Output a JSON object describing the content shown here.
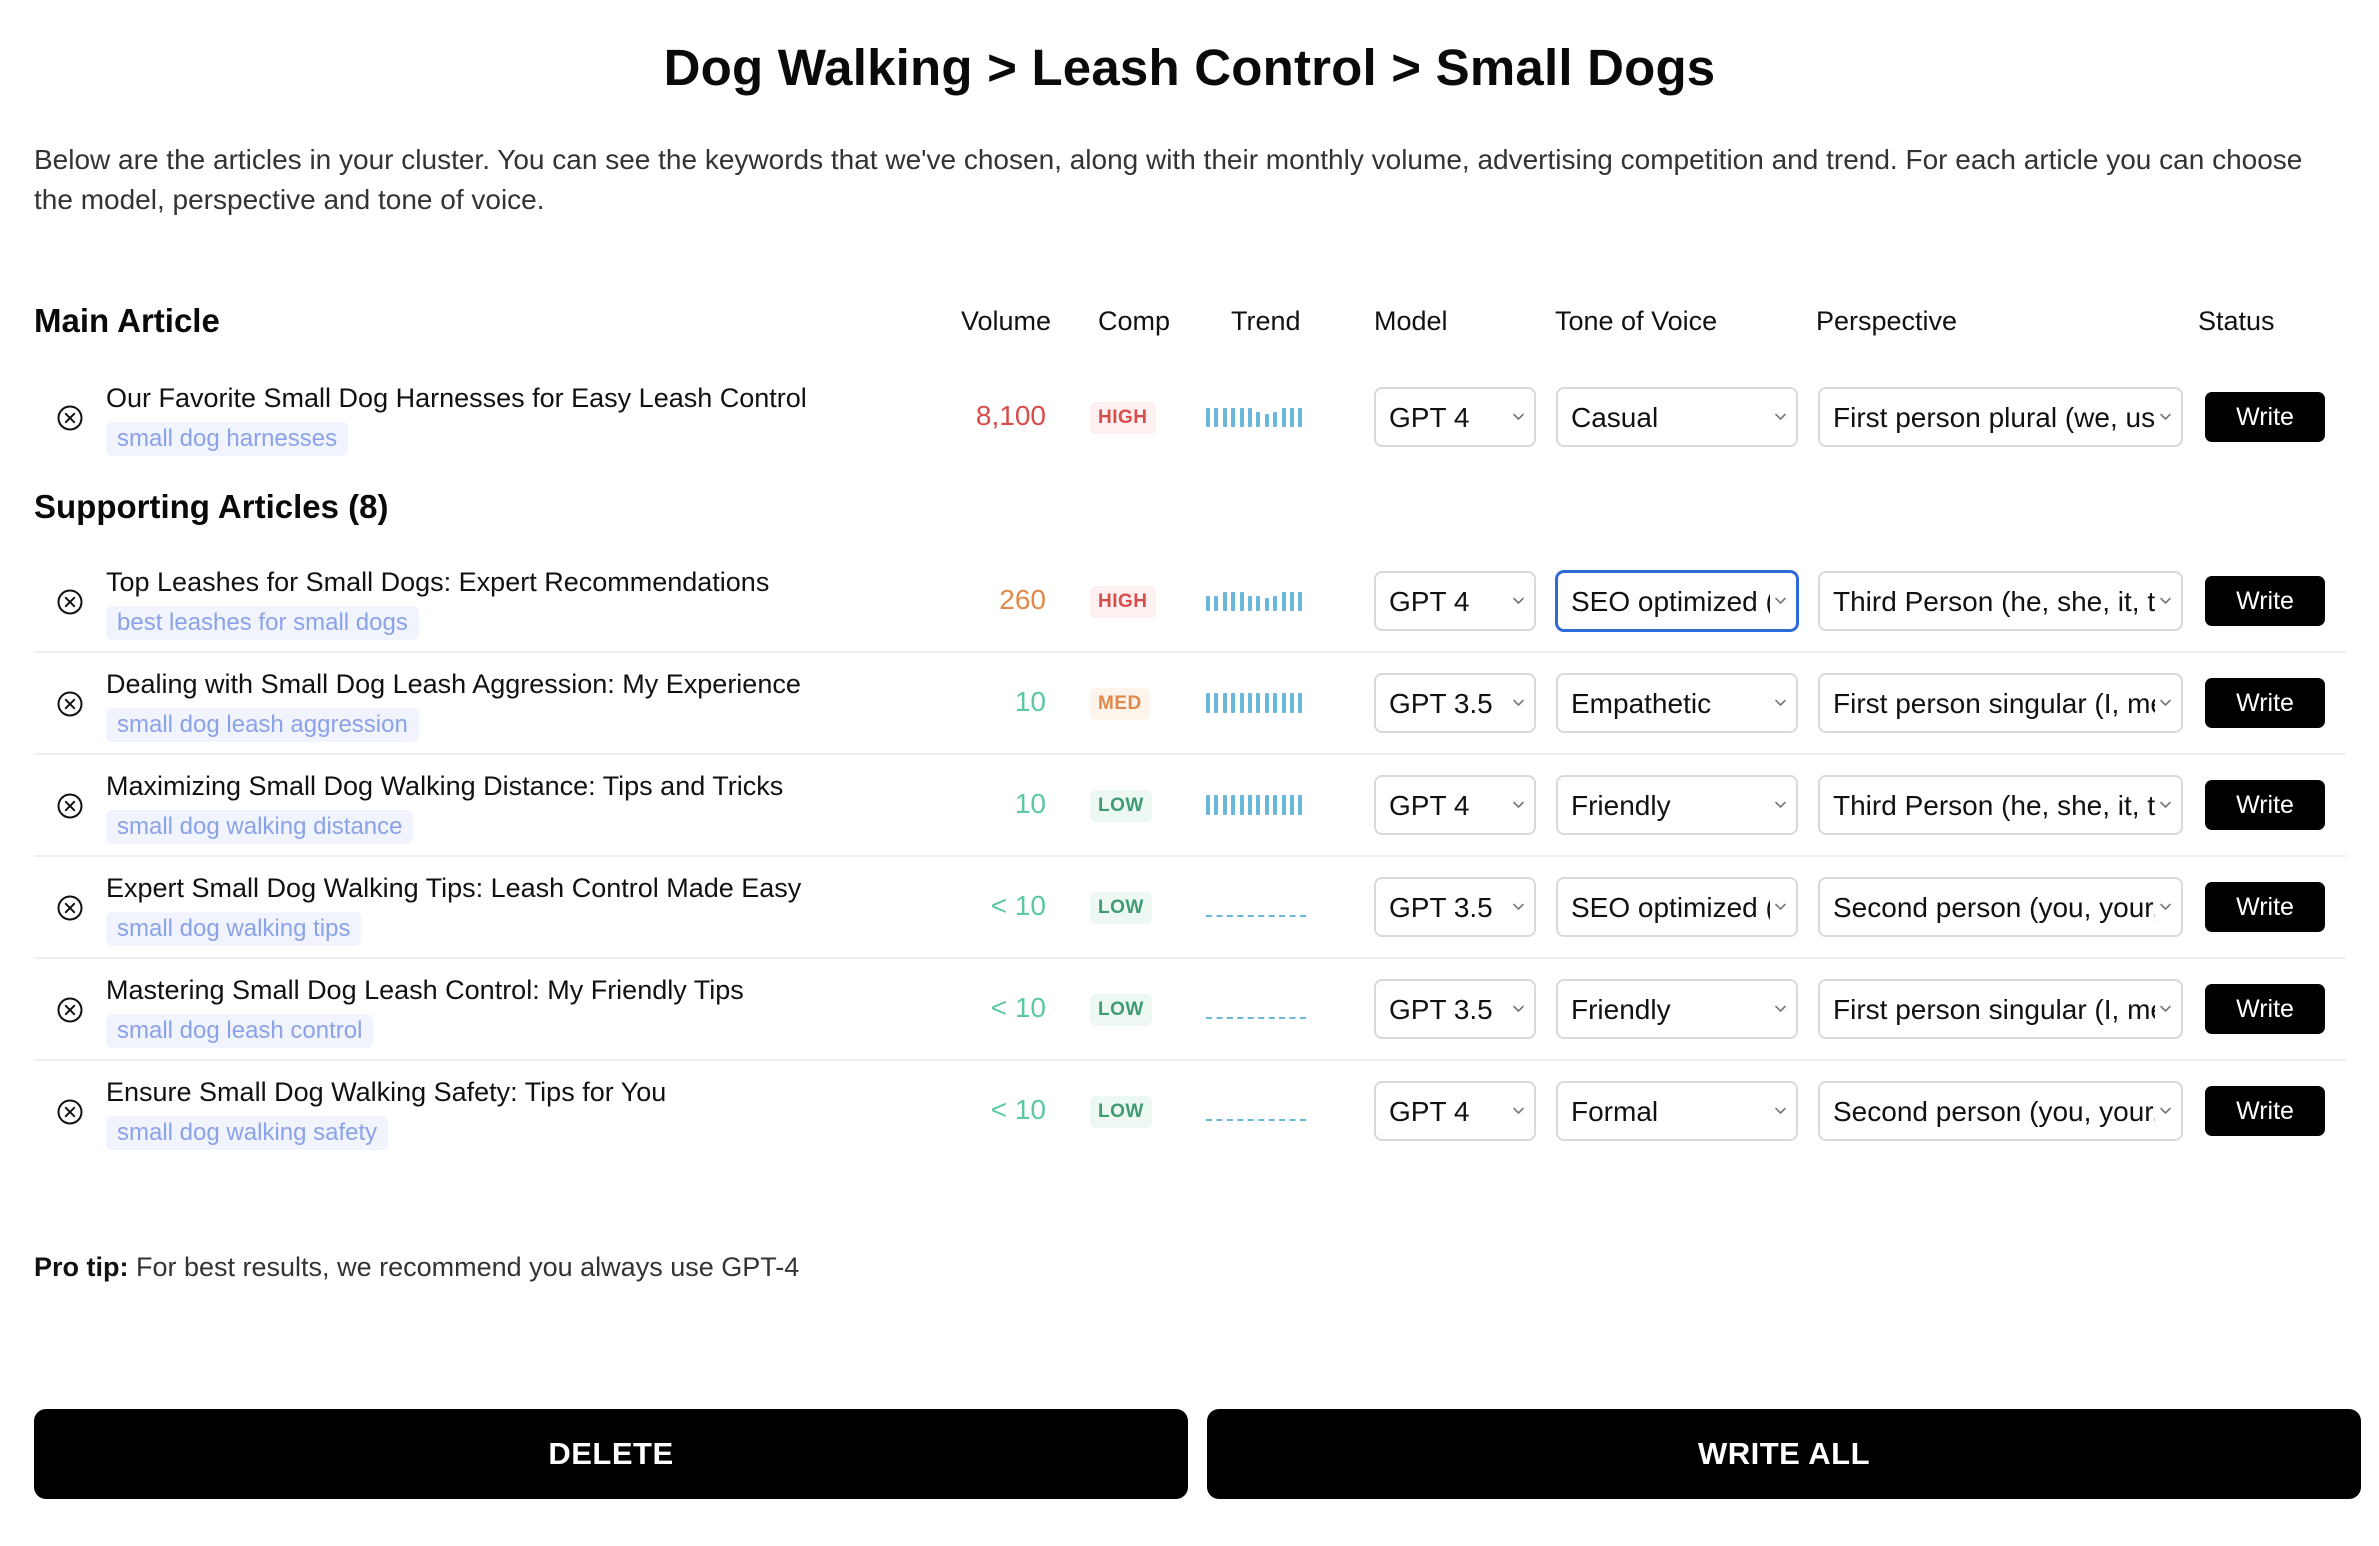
{
  "page": {
    "title": "Dog Walking > Leash Control > Small Dogs",
    "intro": "Below are the articles in your cluster. You can see the keywords that we've chosen, along with their monthly volume, advertising competition and trend. For each article you can choose the model, perspective and tone of voice."
  },
  "columns": {
    "main_article": "Main Article",
    "volume": "Volume",
    "comp": "Comp",
    "trend": "Trend",
    "model": "Model",
    "tone": "Tone of Voice",
    "perspective": "Perspective",
    "status": "Status"
  },
  "supporting_label": "Supporting Articles (8)",
  "main_article": {
    "title": "Our Favorite Small Dog Harnesses for Easy Leash Control",
    "keyword": "small dog harnesses",
    "volume": "8,100",
    "volume_color": "#d94c4c",
    "comp": "HIGH",
    "comp_level": "high",
    "trend": [
      0.85,
      0.85,
      0.85,
      0.85,
      0.85,
      0.85,
      0.7,
      0.6,
      0.7,
      0.85,
      0.85,
      0.85
    ],
    "model": "GPT 4",
    "tone": "Casual",
    "perspective": "First person plural (we, us, our)",
    "status": "Write"
  },
  "supporting_articles": [
    {
      "title": "Top Leashes for Small Dogs: Expert Recommendations",
      "keyword": "best leashes for small dogs",
      "volume": "260",
      "volume_color": "#e0894a",
      "comp": "HIGH",
      "comp_level": "high",
      "trend": [
        0.7,
        0.7,
        0.85,
        0.85,
        0.85,
        0.7,
        0.7,
        0.6,
        0.7,
        0.85,
        0.85,
        0.85
      ],
      "model": "GPT 4",
      "tone": "SEO optimized (",
      "tone_focused": true,
      "perspective": "Third Person (he, she, it, they)",
      "status": "Write"
    },
    {
      "title": "Dealing with Small Dog Leash Aggression: My Experience",
      "keyword": "small dog leash aggression",
      "volume": "10",
      "volume_color": "#5cc8a3",
      "comp": "MED",
      "comp_level": "med",
      "trend": [
        0.9,
        0.9,
        0.9,
        0.9,
        0.9,
        0.9,
        0.9,
        0.9,
        0.9,
        0.9,
        0.9,
        0.9
      ],
      "model": "GPT 3.5",
      "tone": "Empathetic",
      "tone_focused": false,
      "perspective": "First person singular (I, me, my)",
      "status": "Write"
    },
    {
      "title": "Maximizing Small Dog Walking Distance: Tips and Tricks",
      "keyword": "small dog walking distance",
      "volume": "10",
      "volume_color": "#5cc8a3",
      "comp": "LOW",
      "comp_level": "low",
      "trend": [
        0.9,
        0.9,
        0.9,
        0.9,
        0.9,
        0.9,
        0.9,
        0.9,
        0.9,
        0.9,
        0.9,
        0.9
      ],
      "model": "GPT 4",
      "tone": "Friendly",
      "tone_focused": false,
      "perspective": "Third Person (he, she, it, they)",
      "status": "Write"
    },
    {
      "title": "Expert Small Dog Walking Tips: Leash Control Made Easy",
      "keyword": "small dog walking tips",
      "volume": "< 10",
      "volume_color": "#5cc8a3",
      "comp": "LOW",
      "comp_level": "low",
      "trend": [],
      "model": "GPT 3.5",
      "tone": "SEO optimized (",
      "tone_focused": false,
      "perspective": "Second person (you, your, yours)",
      "status": "Write"
    },
    {
      "title": "Mastering Small Dog Leash Control: My Friendly Tips",
      "keyword": "small dog leash control",
      "volume": "< 10",
      "volume_color": "#5cc8a3",
      "comp": "LOW",
      "comp_level": "low",
      "trend": [],
      "model": "GPT 3.5",
      "tone": "Friendly",
      "tone_focused": false,
      "perspective": "First person singular (I, me, my)",
      "status": "Write"
    },
    {
      "title": "Ensure Small Dog Walking Safety: Tips for You",
      "keyword": "small dog walking safety",
      "volume": "< 10",
      "volume_color": "#5cc8a3",
      "comp": "LOW",
      "comp_level": "low",
      "trend": [],
      "model": "GPT 4",
      "tone": "Formal",
      "tone_focused": false,
      "perspective": "Second person (you, your, yours)",
      "status": "Write"
    }
  ],
  "pro_tip": {
    "label": "Pro tip:",
    "text": " For best results, we recommend you always use GPT-4"
  },
  "actions": {
    "delete": "DELETE",
    "write_all": "WRITE ALL"
  },
  "colors": {
    "trend_bar": "#6ab7d9",
    "keyword_text": "#8aa3e8",
    "focus_ring": "#2f6ad9"
  },
  "icons": {
    "remove": "circle-x-icon",
    "chevron": "chevron-down-icon"
  }
}
